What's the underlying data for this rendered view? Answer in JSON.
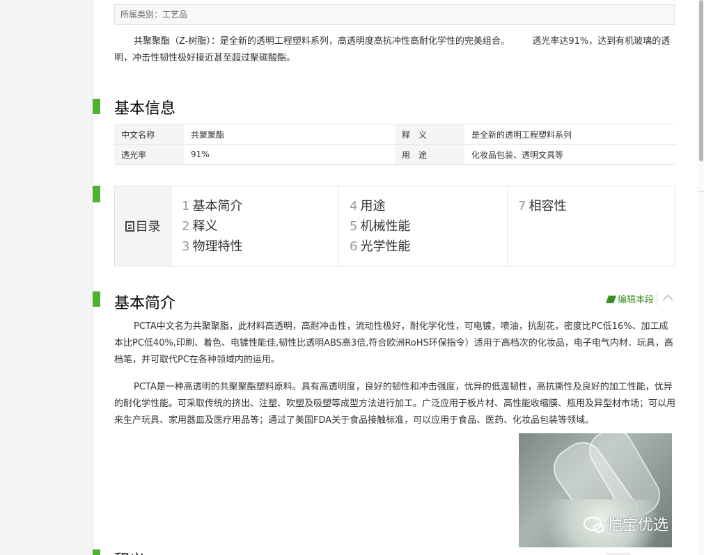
{
  "category": {
    "text": "所属类别：工艺品"
  },
  "intro": "共聚聚酯（Z-树脂）：是全新的透明工程塑料系列，高透明度高抗冲性高耐化学性的完美组合。　　　透光率达91%，达到有机玻璃的透明，冲击性韧性极好接近甚至超过聚碳酸酯。",
  "basic_info": {
    "title": "基本信息",
    "rows": [
      {
        "k1": "中文名称",
        "v1": "共聚聚酯",
        "k2": "释　义",
        "v2": "是全新的透明工程塑料系列"
      },
      {
        "k1": "透光率",
        "v1": "91%",
        "k2": "用　途",
        "v2": "化妆品包装、透明文具等"
      }
    ]
  },
  "toc": {
    "heading": "目录",
    "items": [
      {
        "num": "1",
        "label": "基本简介"
      },
      {
        "num": "2",
        "label": "释义"
      },
      {
        "num": "3",
        "label": "物理特性"
      },
      {
        "num": "4",
        "label": "用途"
      },
      {
        "num": "5",
        "label": "机械性能"
      },
      {
        "num": "6",
        "label": "光学性能"
      },
      {
        "num": "7",
        "label": "相容性"
      }
    ]
  },
  "section": {
    "title": "基本简介",
    "edit_label": "编辑本段",
    "p1": "PCTA中文名为共聚聚脂，此材料高透明，高耐冲击性，流动性极好，耐化学化性，可电镀，喷油，抗刮花，密度比PC低16%、加工成本比PC低40%,印刷、着色、电镀性能佳,韧性比透明ABS高3倍,符合欧洲RoHS环保指令）适用于高档次的化妆品，电子电气内材．玩具，高档笔，并可取代PC在各种领域内的运用。",
    "p2": "PCTA是一种高透明的共聚聚酯塑料原料。具有高透明度，良好的韧性和冲击强度，优异的低温韧性，高抗撕性及良好的加工性能，优异的耐化学性能。可采取传统的挤出、注塑、吹塑及吸塑等成型方法进行加工。广泛应用于板片材、高性能收缩膜、瓶用及异型材市场；可以用来生产玩具、家用器皿及医疗用品等；通过了美国FDA关于食品接触标准，可以应用于食品、医药、化妆品包装等领域。"
  },
  "watermark": "恺宝优选",
  "next_section_partial": "释义",
  "colors": {
    "accent_green": "#4fb033",
    "edit_green": "#3d8f24"
  }
}
